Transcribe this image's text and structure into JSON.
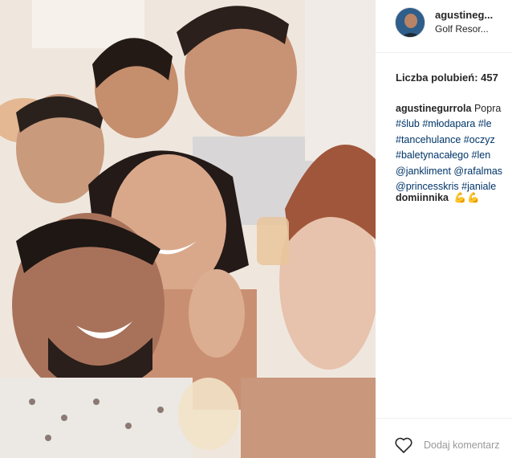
{
  "post": {
    "image_alt": "group selfie photo",
    "colors": {
      "link": "#003569",
      "muted": "#999999",
      "border": "#efefef"
    }
  },
  "header": {
    "username": "agustineg...",
    "location": "Golf Resor..."
  },
  "likes": {
    "text": "Liczba polubień: 457"
  },
  "caption": {
    "author": "agustinegurrola",
    "text_start": "Popra",
    "tags": [
      "#ślub #młodapara #le",
      "#tancehulance #oczyz",
      "#baletynacałego #len",
      "@jankliment @rafalmas",
      "@princesskris #janiale"
    ]
  },
  "comment": {
    "author": "domiinnika",
    "emoji": "💪💪"
  },
  "footer": {
    "like_icon": "heart-outline-icon",
    "add_comment_placeholder": "Dodaj komentarz"
  }
}
